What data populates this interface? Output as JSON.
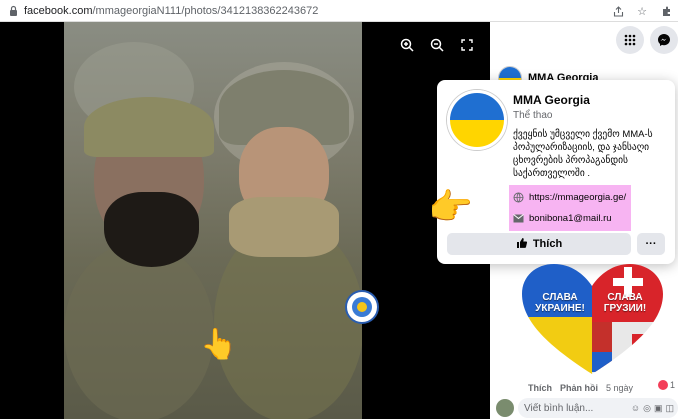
{
  "browser": {
    "url_host": "facebook.com",
    "url_path": "/mmageorgiaN111/photos/3412138362243672"
  },
  "side": {
    "page_name": "MMA Georgia"
  },
  "card": {
    "name": "MMA Georgia",
    "category": "Thể thao",
    "description": "ქვეყნის უმცველი ქვემო MMA-ს პოპულარიზაციის, და ჯანსაღი ცხოვრების პროპაგანდის საქართველოში .",
    "website": "https://mmageorgia.ge/",
    "email": "bonibona1@mail.ru",
    "like_label": "Thích",
    "more_label": "···"
  },
  "comment": {
    "image_left": "СЛАВА УКРАИНЕ!",
    "image_right": "СЛАВА ГРУЗИИ!",
    "like": "Thích",
    "reply": "Phản hồi",
    "time": "5 ngày",
    "reaction_count": "1"
  },
  "composer": {
    "placeholder": "Viết bình luận..."
  },
  "colors": {
    "flag_blue": "#1f6fd1",
    "flag_yellow": "#ffd500",
    "highlight": "#f7b4f2"
  },
  "icons": [
    "lock-icon",
    "share-icon",
    "star-icon",
    "extensions-icon",
    "zoom-in-icon",
    "zoom-out-icon",
    "fullscreen-icon",
    "menu-grid-icon",
    "messenger-icon",
    "globe-icon",
    "envelope-icon",
    "like-icon",
    "pointing-hand-emoji"
  ]
}
